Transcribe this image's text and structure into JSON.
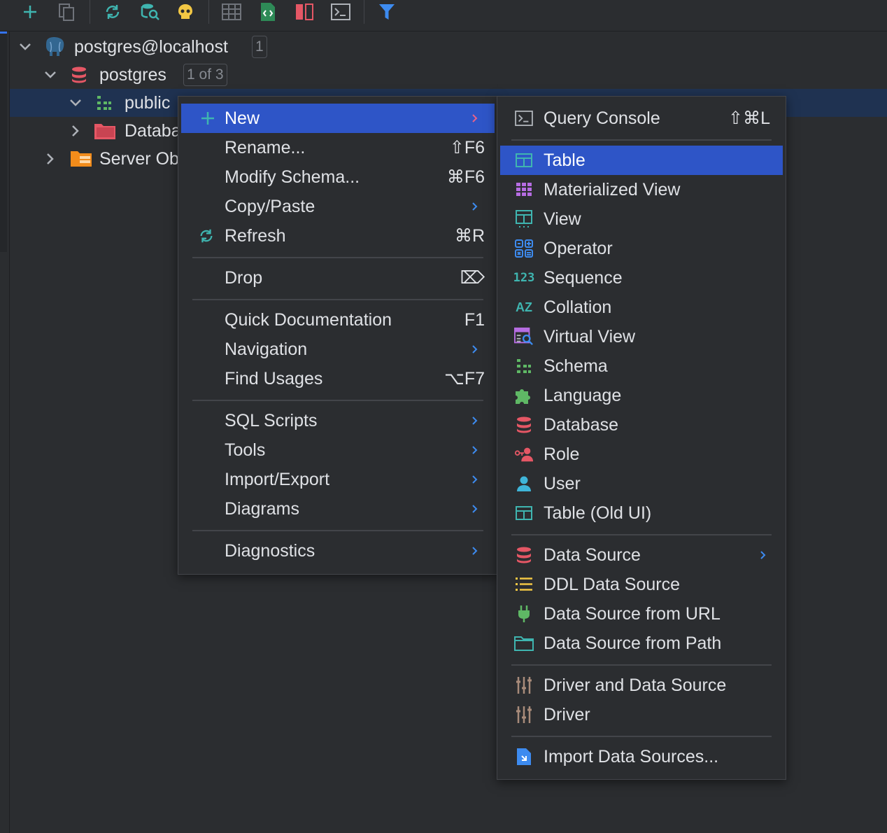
{
  "toolbar": {
    "buttons": [
      "add-icon",
      "duplicate-icon",
      "refresh-icon",
      "database-search-icon",
      "skull-icon",
      "table-view-icon",
      "ddl-icon",
      "compare-icon",
      "console-icon",
      "filter-icon"
    ]
  },
  "tree": {
    "connection": {
      "label": "postgres@localhost",
      "badge": "1"
    },
    "database": {
      "label": "postgres",
      "badge": "1 of 3"
    },
    "schema": {
      "label": "public"
    },
    "databases_folder": {
      "label": "Databa"
    },
    "server_objects": {
      "label": "Server Ob"
    }
  },
  "context_menu": {
    "items": [
      {
        "label": "New",
        "shortcut": "",
        "submenu": true,
        "icon": "plus-icon"
      },
      {
        "label": "Rename...",
        "shortcut": "⇧F6"
      },
      {
        "label": "Modify Schema...",
        "shortcut": "⌘F6"
      },
      {
        "label": "Copy/Paste",
        "submenu": true
      },
      {
        "label": "Refresh",
        "shortcut": "⌘R",
        "icon": "refresh-icon"
      },
      {
        "label": "Drop",
        "shortcut": "⌦"
      },
      {
        "label": "Quick Documentation",
        "shortcut": "F1"
      },
      {
        "label": "Navigation",
        "submenu": true
      },
      {
        "label": "Find Usages",
        "shortcut": "⌥F7"
      },
      {
        "label": "SQL Scripts",
        "submenu": true
      },
      {
        "label": "Tools",
        "submenu": true
      },
      {
        "label": "Import/Export",
        "submenu": true
      },
      {
        "label": "Diagrams",
        "submenu": true
      },
      {
        "label": "Diagnostics",
        "submenu": true
      }
    ]
  },
  "new_submenu": {
    "items": [
      {
        "label": "Query Console",
        "shortcut": "⇧⌘L",
        "icon": "console-icon"
      },
      {
        "label": "Table",
        "icon": "table-icon"
      },
      {
        "label": "Materialized View",
        "icon": "materialized-view-icon"
      },
      {
        "label": "View",
        "icon": "view-icon"
      },
      {
        "label": "Operator",
        "icon": "operator-icon"
      },
      {
        "label": "Sequence",
        "icon": "sequence-icon",
        "icon_text": "123"
      },
      {
        "label": "Collation",
        "icon": "collation-icon",
        "icon_text": "AZ"
      },
      {
        "label": "Virtual View",
        "icon": "virtual-view-icon"
      },
      {
        "label": "Schema",
        "icon": "schema-icon"
      },
      {
        "label": "Language",
        "icon": "puzzle-icon"
      },
      {
        "label": "Database",
        "icon": "database-icon"
      },
      {
        "label": "Role",
        "icon": "role-icon"
      },
      {
        "label": "User",
        "icon": "user-icon"
      },
      {
        "label": "Table (Old UI)",
        "icon": "table-icon"
      },
      {
        "label": "Data Source",
        "submenu": true,
        "icon": "database-icon"
      },
      {
        "label": "DDL Data Source",
        "icon": "ddl-list-icon"
      },
      {
        "label": "Data Source from URL",
        "icon": "plug-icon"
      },
      {
        "label": "Data Source from Path",
        "icon": "folder-icon"
      },
      {
        "label": "Driver and Data Source",
        "icon": "driver-icon"
      },
      {
        "label": "Driver",
        "icon": "driver-icon"
      },
      {
        "label": "Import Data Sources...",
        "icon": "import-icon"
      }
    ]
  },
  "colors": {
    "accent": "#2e55c7",
    "selection": "#1f3251",
    "background": "#2b2d30",
    "text": "#dfe1e5",
    "teal": "#3fb5b0",
    "red": "#e55765",
    "green": "#5fb865",
    "blue": "#3d8bf0",
    "purple": "#b66de2",
    "orange": "#f28c1b",
    "yellow": "#f2c744"
  }
}
